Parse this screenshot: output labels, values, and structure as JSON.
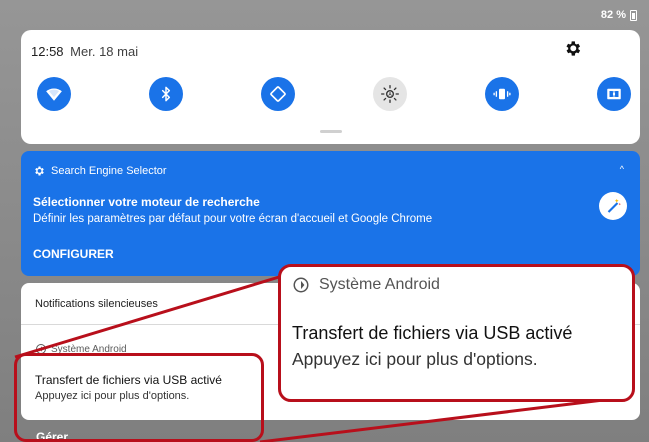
{
  "status_bar": {
    "battery_percent": "82 %"
  },
  "quick_settings": {
    "time": "12:58",
    "date": "Mer. 18 mai",
    "toggles": [
      {
        "icon": "wifi-icon",
        "state": "on"
      },
      {
        "icon": "bluetooth-icon",
        "state": "on"
      },
      {
        "icon": "auto-rotate-icon",
        "state": "on"
      },
      {
        "icon": "auto-brightness-icon",
        "state": "off"
      },
      {
        "icon": "vibrate-icon",
        "state": "on"
      },
      {
        "icon": "dolby-icon",
        "state": "on"
      }
    ]
  },
  "search_engine_notification": {
    "app_name": "Search Engine Selector",
    "expand_symbol": "^",
    "title": "Sélectionner votre moteur de recherche",
    "text": "Définir les paramètres par défaut pour votre écran d'accueil et Google Chrome",
    "action": "CONFIGURER"
  },
  "silent_notifications": {
    "header": "Notifications silencieuses",
    "app_name": "Système Android",
    "title": "Transfert de fichiers via USB activé",
    "text": "Appuyez ici pour plus d'options."
  },
  "footer": {
    "manage_label": "Gérer"
  },
  "zoom": {
    "app_name": "Système Android",
    "title": "Transfert de fichiers via USB activé",
    "text": "Appuyez ici pour plus d'options."
  },
  "colors": {
    "accent": "#1a73e8",
    "highlight": "#b80f1b"
  }
}
